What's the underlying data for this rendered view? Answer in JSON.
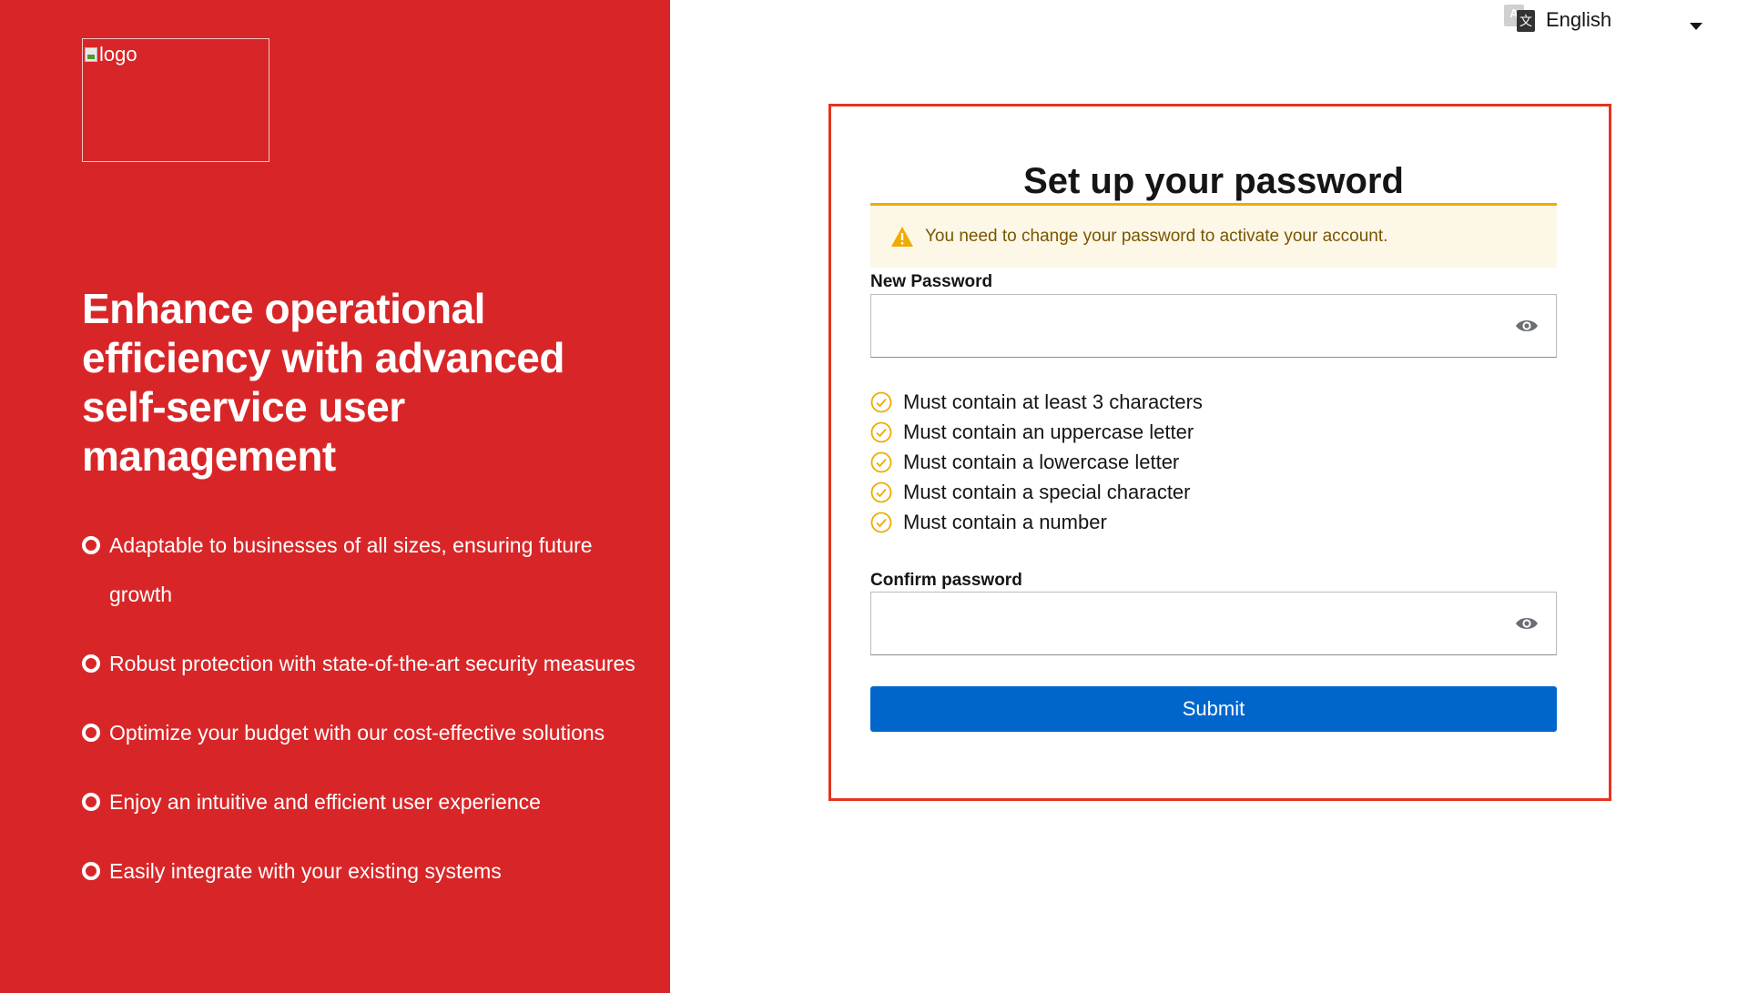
{
  "brand": {
    "logo_alt": "logo",
    "colors": {
      "panel": "#d82628",
      "primary": "#0066cc",
      "warning": "#f0ab00",
      "check": "#f0ab00",
      "card_border": "#e5331f"
    }
  },
  "hero": {
    "title": "Enhance operational efficiency with advanced self-service user management",
    "features": [
      "Adaptable to businesses of all sizes, ensuring future growth",
      "Robust protection with state-of-the-art security measures",
      "Optimize your budget with our cost-effective solutions",
      "Enjoy an intuitive and efficient user experience",
      "Easily integrate with your existing systems"
    ]
  },
  "language": {
    "selected": "English",
    "icon": "translate-icon"
  },
  "form": {
    "title": "Set up your password",
    "alert": "You need to change your password to activate your account.",
    "new_password_label": "New Password",
    "new_password_value": "",
    "rules": [
      "Must contain at least 3 characters",
      "Must contain an uppercase letter",
      "Must contain a lowercase letter",
      "Must contain a special character",
      "Must contain a number"
    ],
    "confirm_password_label": "Confirm password",
    "confirm_password_value": "",
    "submit_label": "Submit"
  }
}
